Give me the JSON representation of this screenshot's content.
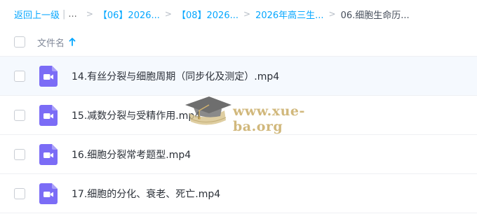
{
  "breadcrumb": {
    "back": "返回上一级",
    "ellipsis": "...",
    "items": [
      "【06】2026...",
      "【08】2026...",
      "2026年高三生..."
    ],
    "current": "06.细胞生命历..."
  },
  "header": {
    "name_label": "文件名",
    "sort_icon": "arrow-up-icon"
  },
  "files": [
    {
      "name": "14.有丝分裂与细胞周期（同步化及测定）.mp4",
      "icon": "video-file-icon"
    },
    {
      "name": "15.减数分裂与受精作用.mp4",
      "icon": "video-file-icon"
    },
    {
      "name": "16.细胞分裂常考题型.mp4",
      "icon": "video-file-icon"
    },
    {
      "name": "17.细胞的分化、衰老、死亡.mp4",
      "icon": "video-file-icon"
    }
  ],
  "watermark": {
    "text": "www.xue-ba.org",
    "icon": "graduation-cap-icon"
  },
  "colors": {
    "link": "#06a7ff",
    "icon_purple": "#7b6cf6",
    "hover_row": "#f5f9fe"
  }
}
